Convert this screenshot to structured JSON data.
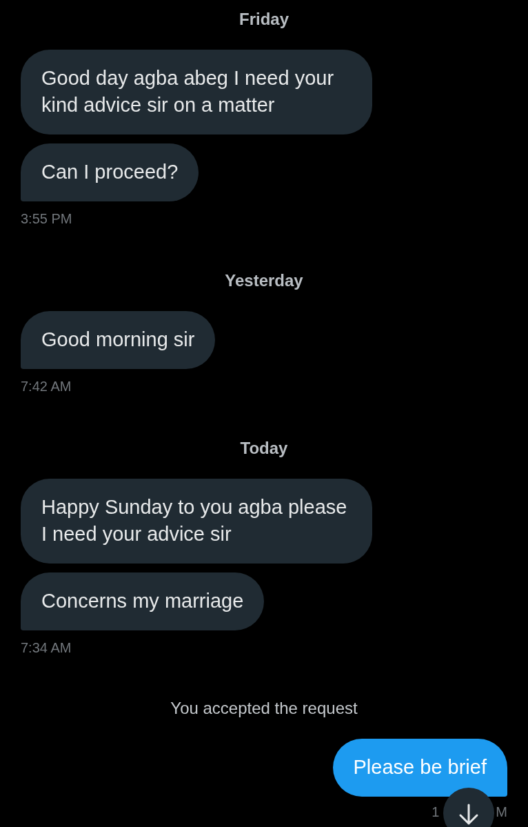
{
  "conversation": [
    {
      "kind": "date",
      "text": "Friday"
    },
    {
      "kind": "incoming",
      "text": "Good day agba abeg I need your kind advice sir on a matter"
    },
    {
      "kind": "incoming",
      "text": "Can I proceed?"
    },
    {
      "kind": "time",
      "text": "3:55 PM"
    },
    {
      "kind": "date",
      "text": "Yesterday"
    },
    {
      "kind": "incoming",
      "text": "Good morning sir"
    },
    {
      "kind": "time",
      "text": "7:42 AM"
    },
    {
      "kind": "date",
      "text": "Today"
    },
    {
      "kind": "incoming",
      "text": "Happy Sunday to you agba please I need your advice sir"
    },
    {
      "kind": "incoming",
      "text": "Concerns my marriage"
    },
    {
      "kind": "time",
      "text": "7:34 AM"
    },
    {
      "kind": "notice",
      "text": "You accepted the request"
    },
    {
      "kind": "outgoing",
      "text": "Please be brief"
    },
    {
      "kind": "time_covered",
      "start": "1",
      "end": "M"
    }
  ]
}
